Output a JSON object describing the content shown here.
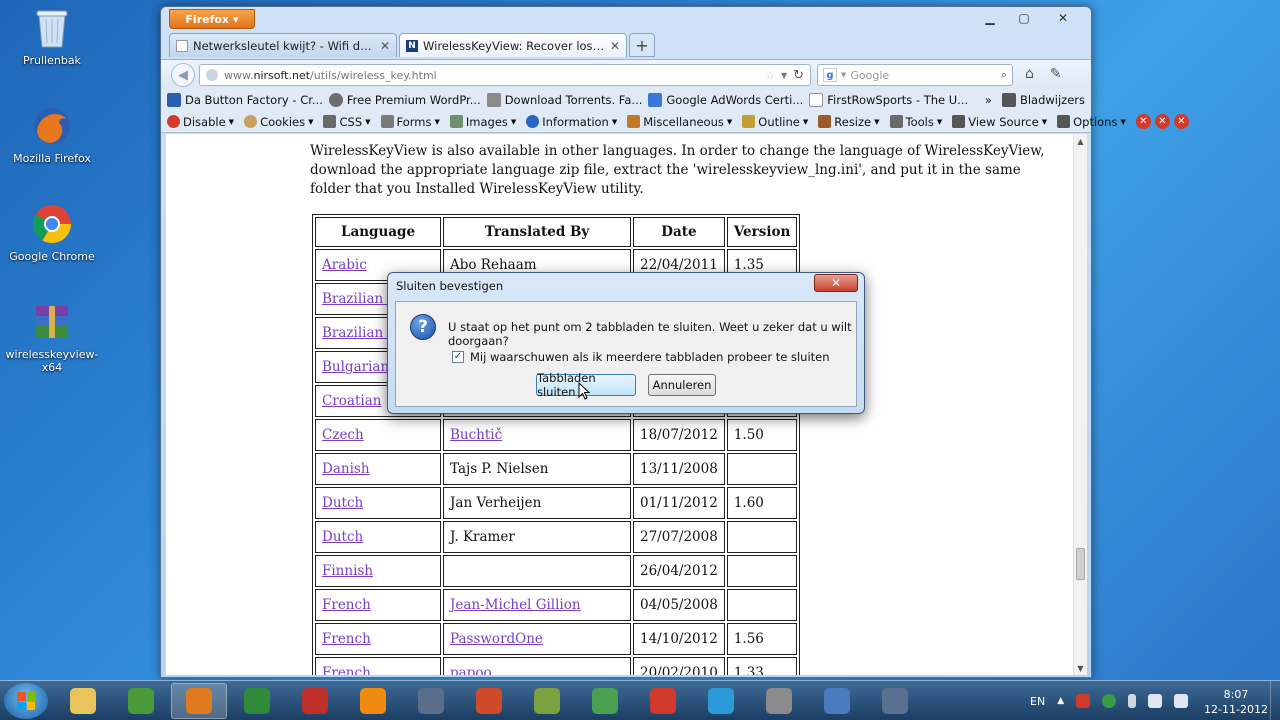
{
  "desktop": {
    "icons": [
      {
        "label": "Prullenbak",
        "icon": "recycle-bin-icon"
      },
      {
        "label": "Mozilla Firefox",
        "icon": "firefox-icon"
      },
      {
        "label": "Google Chrome",
        "icon": "chrome-icon"
      },
      {
        "label": "wirelesskeyview-x64",
        "icon": "winrar-archive-icon"
      }
    ]
  },
  "browser": {
    "menu_button": "Firefox",
    "tabs": [
      {
        "label": "Netwerksleutel kwijt? - Wifi draadloos..."
      },
      {
        "label": "WirelessKeyView: Recover lost WEP/..."
      }
    ],
    "url_prefix": "www.",
    "url_host": "nirsoft.net",
    "url_path": "/utils/wireless_key.html",
    "search_placeholder": "Google",
    "bookmarks": [
      {
        "label": "Da Button Factory - Cr...",
        "color": "#2a5fb0"
      },
      {
        "label": "Free Premium WordPr...",
        "color": "#6d6d6d"
      },
      {
        "label": "Download Torrents. Fa...",
        "color": "#8a8a8a"
      },
      {
        "label": "Google AdWords Certi...",
        "color": "#3a78d8"
      },
      {
        "label": "FirstRowSports - The U...",
        "color": "#ffffff"
      }
    ],
    "bookmarks_menu": "Bladwijzers",
    "devtools": [
      {
        "label": "Disable",
        "color": "#d23a2a"
      },
      {
        "label": "Cookies",
        "color": "#c8a060"
      },
      {
        "label": "CSS",
        "color": "#6a6a6a"
      },
      {
        "label": "Forms",
        "color": "#7a7a7a"
      },
      {
        "label": "Images",
        "color": "#6f8f6f"
      },
      {
        "label": "Information",
        "color": "#2a64c0"
      },
      {
        "label": "Miscellaneous",
        "color": "#c07a2a"
      },
      {
        "label": "Outline",
        "color": "#c0a030"
      },
      {
        "label": "Resize",
        "color": "#a05a2a"
      },
      {
        "label": "Tools",
        "color": "#6a6a6a"
      },
      {
        "label": "View Source",
        "color": "#555555"
      },
      {
        "label": "Options",
        "color": "#555555"
      }
    ]
  },
  "page": {
    "intro": "WirelessKeyView is also available in other languages. In order to change the language of WirelessKeyView, download the appropriate language zip file, extract the 'wirelesskeyview_lng.ini', and put it in the same folder that you Installed WirelessKeyView utility.",
    "table": {
      "headers": [
        "Language",
        "Translated By",
        "Date",
        "Version"
      ],
      "rows": [
        {
          "language": "Arabic",
          "translator": "Abo Rehaam",
          "translator_link": false,
          "date": "22/04/2011",
          "version": "1.35"
        },
        {
          "language": "Brazilian Po",
          "translator": "",
          "translator_link": false,
          "date": "",
          "version": ""
        },
        {
          "language": "Brazilian Po",
          "translator": "",
          "translator_link": false,
          "date": "",
          "version": ""
        },
        {
          "language": "Bulgarian",
          "translator": "",
          "translator_link": false,
          "date": "",
          "version": ""
        },
        {
          "language": "Croatian",
          "translator": "",
          "translator_link": false,
          "date": "",
          "version": ""
        },
        {
          "language": "Czech",
          "translator": "Buchtič",
          "translator_link": true,
          "date": "18/07/2012",
          "version": "1.50"
        },
        {
          "language": "Danish",
          "translator": "Tajs P. Nielsen",
          "translator_link": false,
          "date": "13/11/2008",
          "version": ""
        },
        {
          "language": "Dutch",
          "translator": "Jan Verheijen",
          "translator_link": false,
          "date": "01/11/2012",
          "version": "1.60"
        },
        {
          "language": "Dutch",
          "translator": "J. Kramer",
          "translator_link": false,
          "date": "27/07/2008",
          "version": ""
        },
        {
          "language": "Finnish",
          "translator": "",
          "translator_link": false,
          "date": "26/04/2012",
          "version": ""
        },
        {
          "language": "French",
          "translator": "Jean-Michel Gillion",
          "translator_link": true,
          "date": "04/05/2008",
          "version": ""
        },
        {
          "language": "French",
          "translator": "PasswordOne",
          "translator_link": true,
          "date": "14/10/2012",
          "version": "1.56"
        },
        {
          "language": "French",
          "translator": "papoo",
          "translator_link": true,
          "date": "20/02/2010",
          "version": "1.33"
        }
      ]
    }
  },
  "dialog": {
    "title": "Sluiten bevestigen",
    "message": "U staat op het punt om 2 tabbladen te sluiten. Weet u zeker dat u wilt doorgaan?",
    "checkbox_label": "Mij waarschuwen als ik meerdere tabbladen probeer te sluiten",
    "checkbox_checked": true,
    "confirm_label": "Tabbladen sluiten",
    "cancel_label": "Annuleren"
  },
  "taskbar": {
    "apps": [
      {
        "name": "explorer-icon",
        "color": "#e8c45a"
      },
      {
        "name": "chrome-icon",
        "color": "#4a9a3a"
      },
      {
        "name": "firefox-icon",
        "color": "#e07a20",
        "active": true
      },
      {
        "name": "utorrent-icon",
        "color": "#2f8a3a"
      },
      {
        "name": "filezilla-icon",
        "color": "#c0302a"
      },
      {
        "name": "vlc-icon",
        "color": "#f08a10"
      },
      {
        "name": "tool-icon",
        "color": "#5a6e8a"
      },
      {
        "name": "ccleaner-icon",
        "color": "#d04a2a"
      },
      {
        "name": "chart-icon",
        "color": "#7aa040"
      },
      {
        "name": "download-icon",
        "color": "#4aa050"
      },
      {
        "name": "trend-icon",
        "color": "#d03a2a"
      },
      {
        "name": "skype-icon",
        "color": "#2a9ad8"
      },
      {
        "name": "usb-icon",
        "color": "#8a8a8a"
      },
      {
        "name": "network-icon",
        "color": "#4a7ac0"
      },
      {
        "name": "monitor-icon",
        "color": "#5a7090"
      }
    ],
    "language": "EN",
    "time": "8:07",
    "date": "12-11-2012"
  }
}
